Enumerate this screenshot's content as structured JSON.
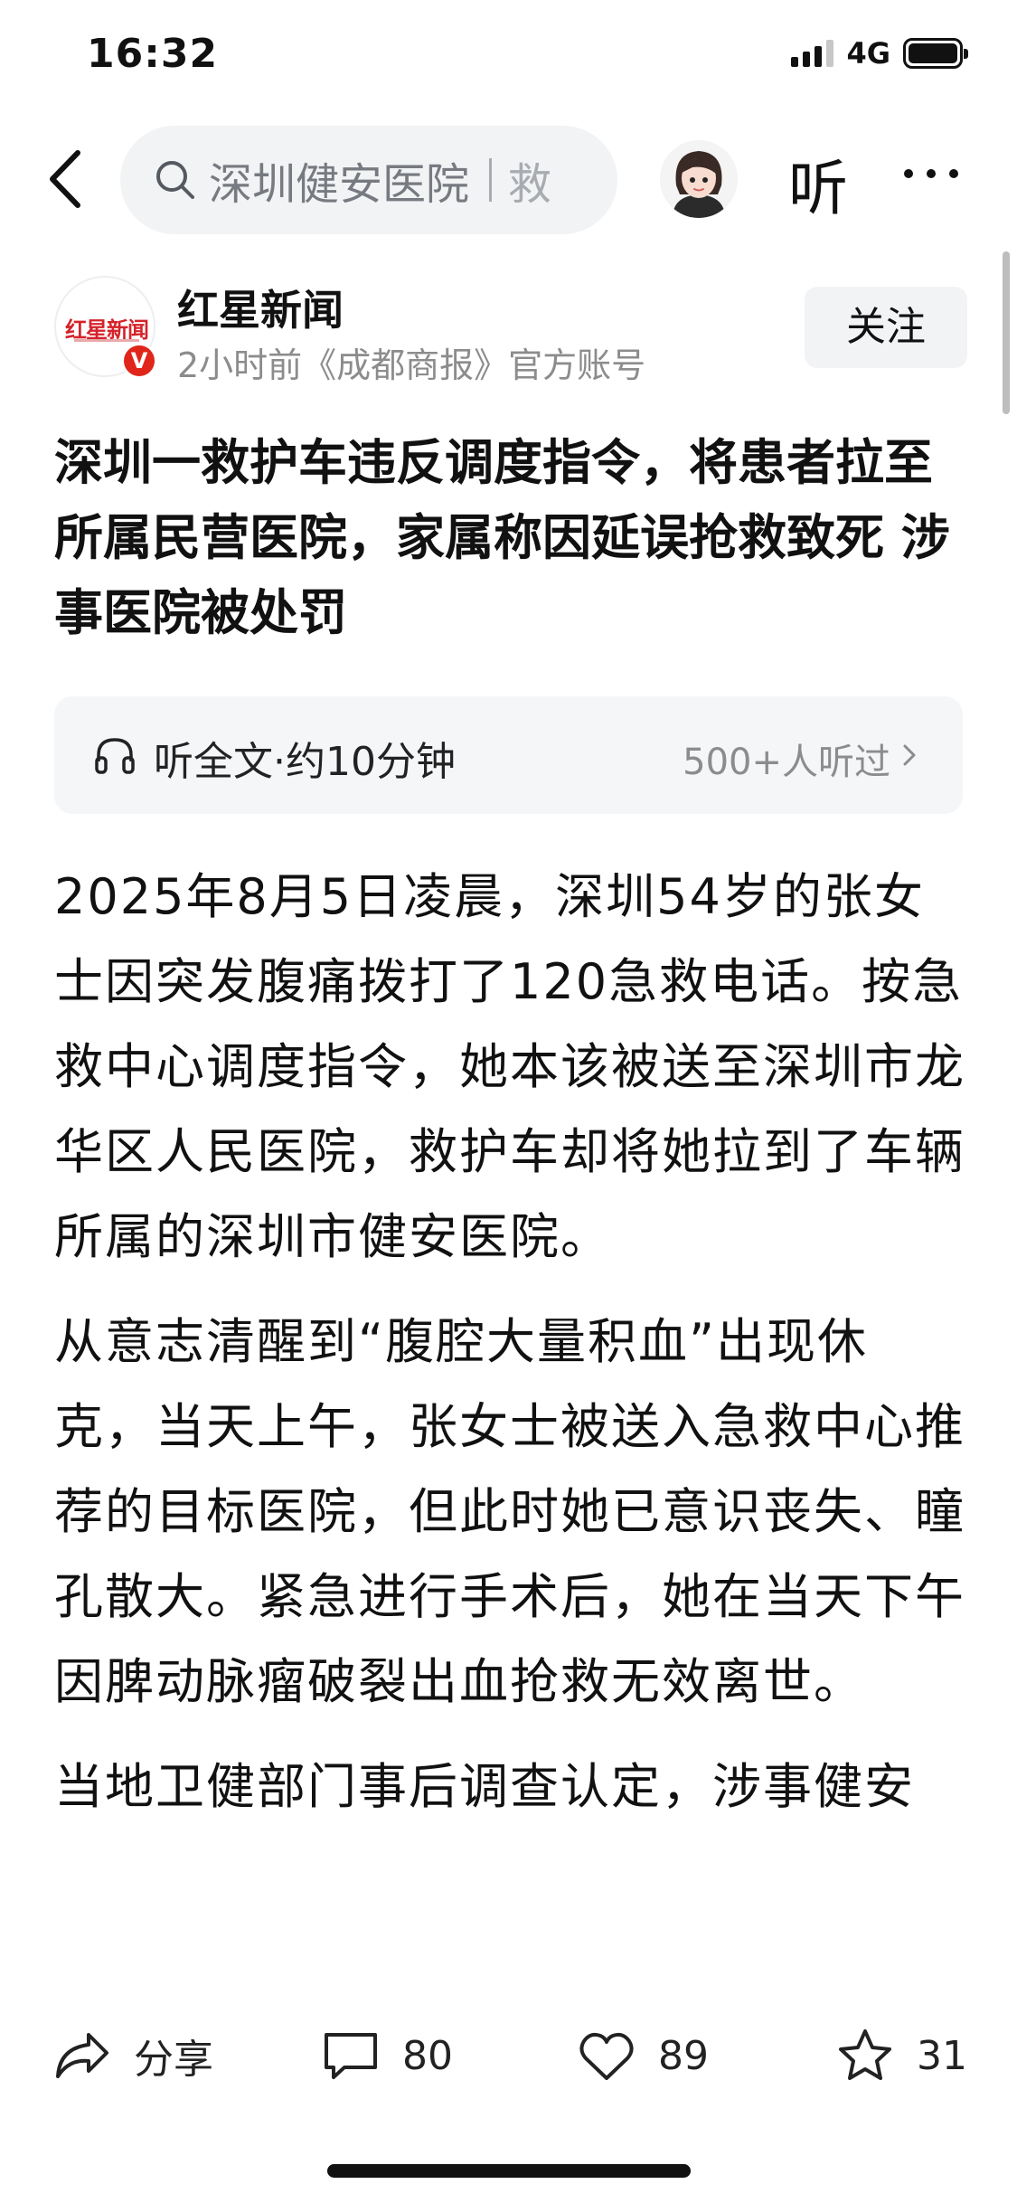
{
  "status_bar": {
    "time": "16:32",
    "network": "4G"
  },
  "nav": {
    "search_query": "深圳健安医院",
    "search_query_more": "救",
    "listen_label": "听"
  },
  "author": {
    "name": "红星新闻",
    "meta": "2小时前《成都商报》官方账号",
    "logo_text": "红星新闻",
    "verified_mark": "V",
    "follow_label": "关注"
  },
  "article": {
    "title": "深圳一救护车违反调度指令，将患者拉至所属民营医院，家属称因延误抢救致死 涉事医院被处罚",
    "listen_card": {
      "label": "听全文·约10分钟",
      "count": "500+人听过"
    },
    "paragraphs": [
      "2025年8月5日凌晨，深圳54岁的张女士因突发腹痛拨打了120急救电话。按急救中心调度指令，她本该被送至深圳市龙华区人民医院，救护车却将她拉到了车辆所属的深圳市健安医院。",
      "从意志清醒到“腹腔大量积血”出现休克，当天上午，张女士被送入急救中心推荐的目标医院，但此时她已意识丧失、瞳孔散大。紧急进行手术后，她在当天下午因脾动脉瘤破裂出血抢救无效离世。",
      "当地卫健部门事后调查认定，涉事健安"
    ]
  },
  "actions": {
    "share_label": "分享",
    "comments": "80",
    "likes": "89",
    "favorites": "31"
  }
}
